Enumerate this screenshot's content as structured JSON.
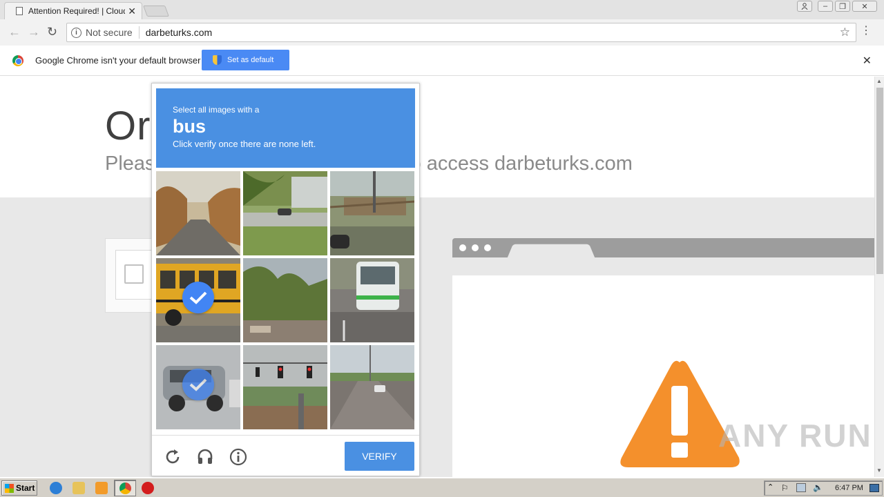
{
  "browser": {
    "tab_title": "Attention Required! | Cloudfl",
    "security_label": "Not secure",
    "url": "darbeturks.com",
    "infobar_text": "Google Chrome isn't your default browser",
    "infobar_button": "Set as default"
  },
  "page": {
    "heading": "Or",
    "subtitle": "Pleas                                          k to access darbeturks.com"
  },
  "captcha": {
    "prompt": "Select all images with a",
    "target": "bus",
    "note": "Click verify once there are none left.",
    "verify_label": "VERIFY",
    "tiles": [
      {
        "selected": false,
        "scene": "road-autumn"
      },
      {
        "selected": false,
        "scene": "park-lawn"
      },
      {
        "selected": false,
        "scene": "roadside-fence"
      },
      {
        "selected": true,
        "scene": "school-bus"
      },
      {
        "selected": false,
        "scene": "trees"
      },
      {
        "selected": false,
        "scene": "bus-front"
      },
      {
        "selected": true,
        "scene": "suv"
      },
      {
        "selected": false,
        "scene": "traffic-lights"
      },
      {
        "selected": false,
        "scene": "highway"
      }
    ]
  },
  "watermark": "ANY RUN",
  "taskbar": {
    "start_label": "Start",
    "clock": "6:47 PM"
  },
  "colors": {
    "captcha_blue": "#4a90e2",
    "warning_orange": "#f4902c",
    "infobar_button": "#4a8af4"
  }
}
